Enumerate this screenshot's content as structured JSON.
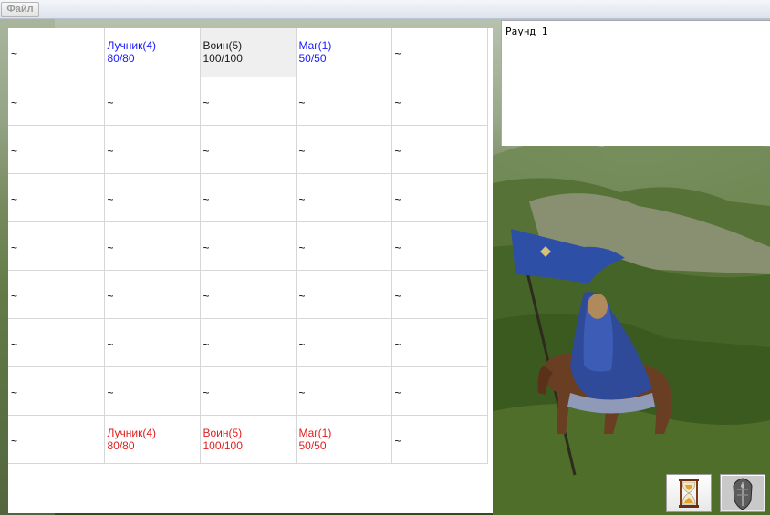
{
  "menu": {
    "file_label": "Файл"
  },
  "log": {
    "lines": [
      "Раунд 1"
    ]
  },
  "grid": {
    "empty_symbol": "~",
    "rows": [
      [
        {
          "name": "~",
          "hp": ""
        },
        {
          "name": "Лучник(4)",
          "hp": "80/80",
          "side": "blue"
        },
        {
          "name": "Воин(5)",
          "hp": "100/100",
          "side": "active"
        },
        {
          "name": "Маг(1)",
          "hp": "50/50",
          "side": "blue"
        },
        {
          "name": "~",
          "hp": ""
        }
      ],
      [
        {
          "name": "~"
        },
        {
          "name": "~"
        },
        {
          "name": "~"
        },
        {
          "name": "~"
        },
        {
          "name": "~"
        }
      ],
      [
        {
          "name": "~"
        },
        {
          "name": "~"
        },
        {
          "name": "~"
        },
        {
          "name": "~"
        },
        {
          "name": "~"
        }
      ],
      [
        {
          "name": "~"
        },
        {
          "name": "~"
        },
        {
          "name": "~"
        },
        {
          "name": "~"
        },
        {
          "name": "~"
        }
      ],
      [
        {
          "name": "~"
        },
        {
          "name": "~"
        },
        {
          "name": "~"
        },
        {
          "name": "~"
        },
        {
          "name": "~"
        }
      ],
      [
        {
          "name": "~"
        },
        {
          "name": "~"
        },
        {
          "name": "~"
        },
        {
          "name": "~"
        },
        {
          "name": "~"
        }
      ],
      [
        {
          "name": "~"
        },
        {
          "name": "~"
        },
        {
          "name": "~"
        },
        {
          "name": "~"
        },
        {
          "name": "~"
        }
      ],
      [
        {
          "name": "~"
        },
        {
          "name": "~"
        },
        {
          "name": "~"
        },
        {
          "name": "~"
        },
        {
          "name": "~"
        }
      ],
      [
        {
          "name": "~",
          "hp": ""
        },
        {
          "name": "Лучник(4)",
          "hp": "80/80",
          "side": "red"
        },
        {
          "name": "Воин(5)",
          "hp": "100/100",
          "side": "red"
        },
        {
          "name": "Маг(1)",
          "hp": "50/50",
          "side": "red"
        },
        {
          "name": "~",
          "hp": ""
        }
      ]
    ]
  },
  "colors": {
    "ally": "#1a1aff",
    "enemy": "#e01e1e",
    "active_bg": "#efefef"
  },
  "buttons": [
    {
      "icon": "hourglass-icon",
      "action": "wait"
    },
    {
      "icon": "shield-icon",
      "action": "defend"
    }
  ]
}
